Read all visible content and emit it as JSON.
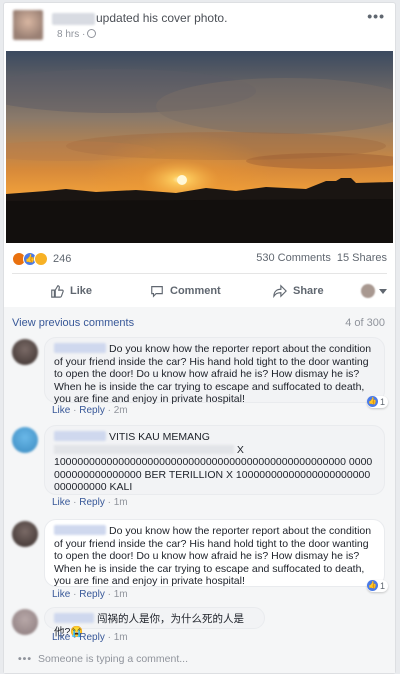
{
  "post": {
    "header_text": "updated his cover photo.",
    "timestamp": "8 hrs ·"
  },
  "stats": {
    "reaction_count": "246",
    "comments": "530 Comments",
    "shares": "15 Shares"
  },
  "actions": {
    "like": "Like",
    "comment": "Comment",
    "share": "Share"
  },
  "comments_section": {
    "view_previous": "View previous comments",
    "pager": "4 of 300",
    "items": [
      {
        "text": "Do you know how the reporter report about the condition of your friend inside the car? His hand hold tight to the door wanting to open the door! Do u know how afraid he is? How dismay he is? When he is inside the car trying to escape and suffocated to death, you are fine and enjoy in private hospital!",
        "like": "Like",
        "reply": "Reply",
        "time": "2m",
        "reactions": "1"
      },
      {
        "text": "VITIS KAU MEMANG",
        "text2": "X",
        "text3": "10000000000000000000000000000000000000000000000000 0000000000000000000 BER TERILLION X 10000000000000000000000000000000 KALI",
        "like": "Like",
        "reply": "Reply",
        "time": "1m"
      },
      {
        "text": "Do you know how the reporter report about the condition of your friend inside the car? His hand hold tight to the door wanting to open the door! Do u know how afraid he is? How dismay he is? When he is inside the car trying to escape and suffocated to death, you are fine and enjoy in private hospital!",
        "like": "Like",
        "reply": "Reply",
        "time": "1m",
        "reactions": "1"
      },
      {
        "text": "闯祸的人是你，为什么死的人是他?😭",
        "like": "Like",
        "reply": "Reply",
        "time": "1m"
      }
    ],
    "typing": "Someone is typing a comment..."
  },
  "colors": {
    "link": "#385898",
    "like_blue": "#4a7ae8",
    "angry_orange": "#e9710f",
    "wow_yellow": "#f7b125"
  }
}
